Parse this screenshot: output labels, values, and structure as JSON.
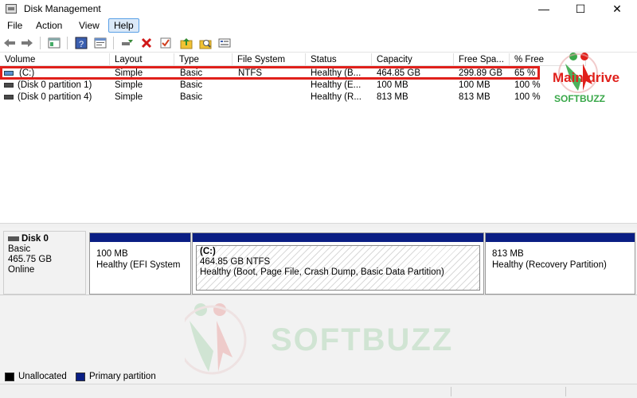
{
  "window": {
    "title": "Disk Management",
    "min_glyph": "—",
    "max_glyph": "☐",
    "close_glyph": "✕"
  },
  "menu": [
    "File",
    "Action",
    "View",
    "Help"
  ],
  "columns": [
    "Volume",
    "Layout",
    "Type",
    "File System",
    "Status",
    "Capacity",
    "Free Spa...",
    "% Free"
  ],
  "volumes": [
    {
      "volume": "(C:)",
      "layout": "Simple",
      "type": "Basic",
      "fs": "NTFS",
      "status": "Healthy (B...",
      "capacity": "464.85 GB",
      "free": "299.89 GB",
      "pct": "65 %"
    },
    {
      "volume": "(Disk 0 partition 1)",
      "layout": "Simple",
      "type": "Basic",
      "fs": "",
      "status": "Healthy (E...",
      "capacity": "100 MB",
      "free": "100 MB",
      "pct": "100 %"
    },
    {
      "volume": "(Disk 0 partition 4)",
      "layout": "Simple",
      "type": "Basic",
      "fs": "",
      "status": "Healthy (R...",
      "capacity": "813 MB",
      "free": "813 MB",
      "pct": "100 %"
    }
  ],
  "annotation": {
    "label": "Main drive",
    "color": "#e0201b"
  },
  "watermark": {
    "text": "SOFTBUZZ"
  },
  "disk": {
    "name": "Disk 0",
    "type": "Basic",
    "size": "465.75 GB",
    "state": "Online",
    "partitions": [
      {
        "title": "",
        "size": "100 MB",
        "status": "Healthy (EFI System"
      },
      {
        "title": "(C:)",
        "size": "464.85 GB NTFS",
        "status": "Healthy (Boot, Page File, Crash Dump, Basic Data Partition)"
      },
      {
        "title": "",
        "size": "813 MB",
        "status": "Healthy (Recovery Partition)"
      }
    ]
  },
  "legend": {
    "unallocated": "Unallocated",
    "primary": "Primary partition"
  },
  "colors": {
    "primary_bar": "#0a1e84",
    "unallocated": "#000000",
    "highlight": "#e0201b"
  }
}
